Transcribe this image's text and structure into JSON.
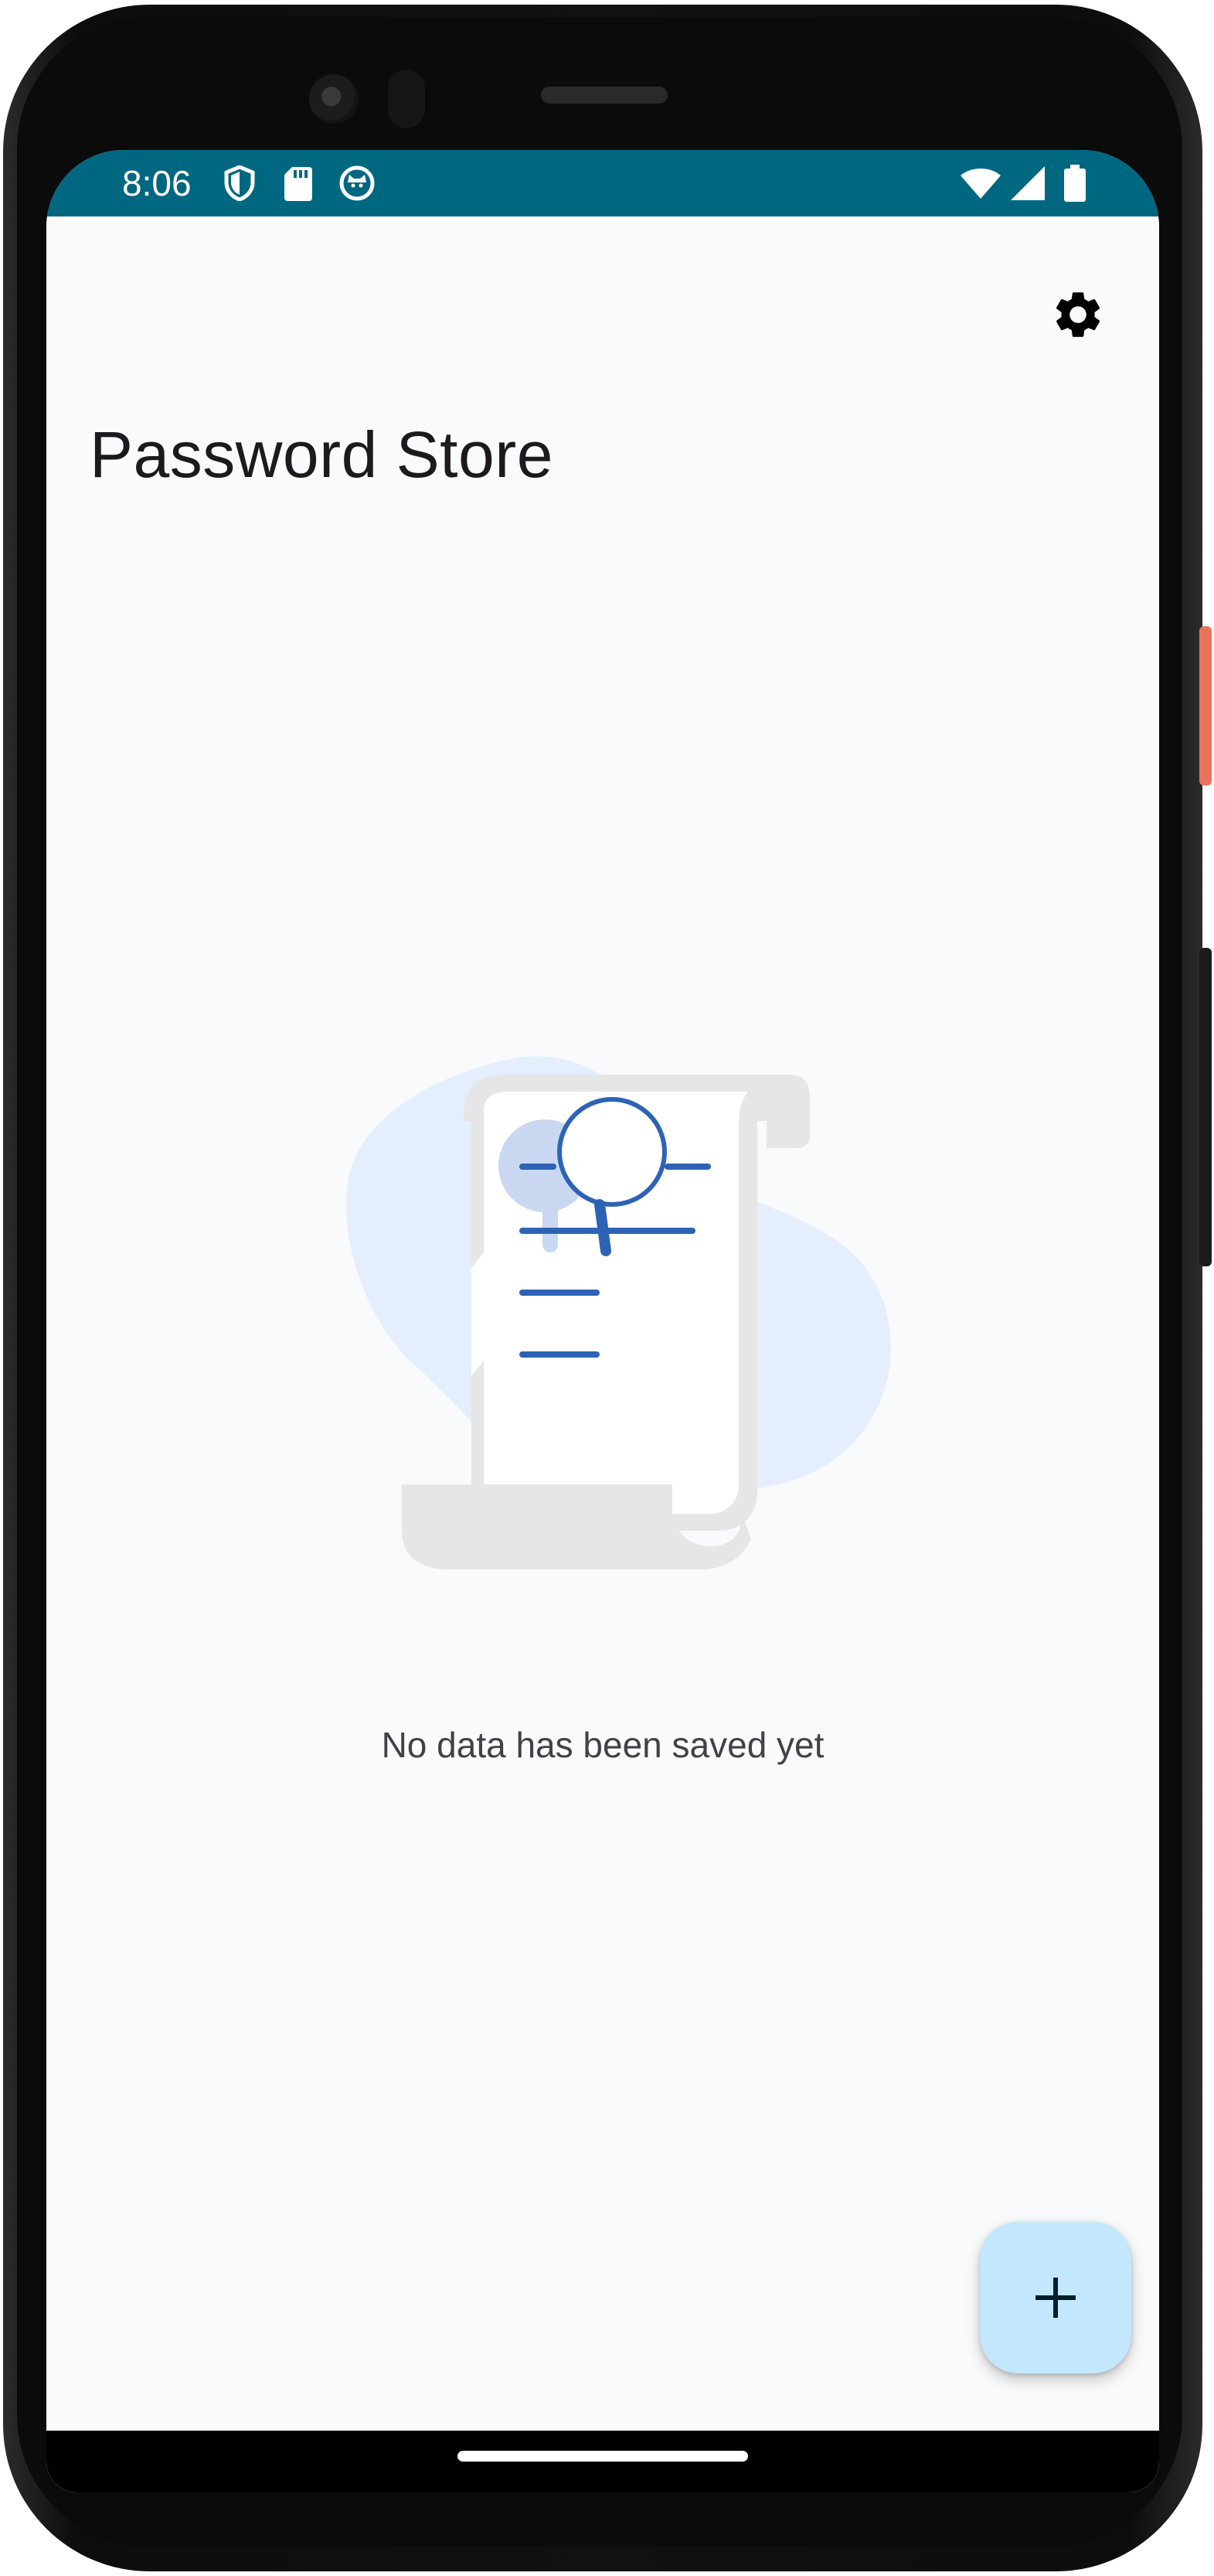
{
  "status_bar": {
    "time": "8:06",
    "background_color": "#006781",
    "left_icons": [
      "vpn-shield-icon",
      "sd-card-icon",
      "cat-notification-icon"
    ],
    "right_icons": [
      "wifi-icon",
      "cellular-signal-icon",
      "battery-icon"
    ]
  },
  "app": {
    "title": "Password Store",
    "settings_icon": "gear-icon",
    "empty_state_text": "No data has been saved yet",
    "fab_icon": "plus-icon",
    "fab_color": "#c3e7fc",
    "accent_color": "#2d63b7"
  },
  "colors": {
    "screen_background": "#f9fafb",
    "illustration_blob": "#e5eefc",
    "scroll_paper": "#e6e6e6"
  }
}
